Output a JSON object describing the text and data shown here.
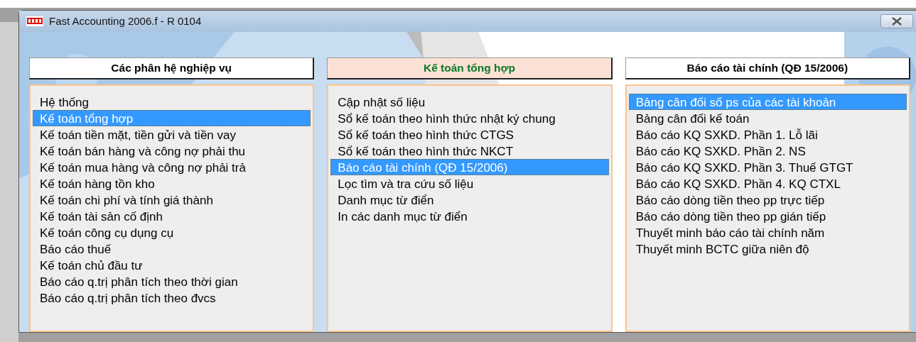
{
  "window": {
    "title": "Fast Accounting 2006.f - R 0104"
  },
  "columns": [
    {
      "header": "Các phân hệ nghiệp vụ",
      "active": false,
      "items": [
        {
          "label": "Hệ thống",
          "selected": false
        },
        {
          "label": "Kế toán tổng hợp",
          "selected": true
        },
        {
          "label": "Kế toán tiền mặt, tiền gửi và tiền vay",
          "selected": false
        },
        {
          "label": "Kế toán bán hàng và công nợ phải thu",
          "selected": false
        },
        {
          "label": "Kế toán mua hàng và công nợ phải trả",
          "selected": false
        },
        {
          "label": "Kế toán hàng tồn kho",
          "selected": false
        },
        {
          "label": "Kế toán chi phí và tính giá thành",
          "selected": false
        },
        {
          "label": "Kế toán tài sản cố định",
          "selected": false
        },
        {
          "label": "Kế toán công cụ dụng cụ",
          "selected": false
        },
        {
          "label": "Báo cáo thuế",
          "selected": false
        },
        {
          "label": "Kế toán chủ đầu tư",
          "selected": false
        },
        {
          "label": "Báo cáo q.trị phân tích theo thời gian",
          "selected": false
        },
        {
          "label": "Báo cáo q.trị phân tích theo đvcs",
          "selected": false
        }
      ]
    },
    {
      "header": "Kế toán tổng hợp",
      "active": true,
      "items": [
        {
          "label": "Cập nhật số liệu",
          "selected": false
        },
        {
          "label": "Sổ kế toán theo hình thức nhật ký chung",
          "selected": false
        },
        {
          "label": "Sổ kế toán theo hình thức CTGS",
          "selected": false
        },
        {
          "label": "Sổ kế toán theo hình thức NKCT",
          "selected": false
        },
        {
          "label": "Báo cáo tài chính (QĐ 15/2006)",
          "selected": true
        },
        {
          "label": "Lọc tìm và tra cứu số liệu",
          "selected": false
        },
        {
          "label": "Danh mục từ điển",
          "selected": false
        },
        {
          "label": "In các danh mục từ điển",
          "selected": false
        }
      ]
    },
    {
      "header": "Báo cáo tài chính (QĐ 15/2006)",
      "active": false,
      "items": [
        {
          "label": "Bảng cân đối số ps của các tài khoản",
          "selected": true
        },
        {
          "label": "Bảng cân đối kế toán",
          "selected": false
        },
        {
          "label": "Báo cáo KQ SXKD. Phần 1. Lỗ lãi",
          "selected": false
        },
        {
          "label": "Báo cáo KQ SXKD. Phần 2. NS",
          "selected": false
        },
        {
          "label": "Báo cáo KQ SXKD. Phần 3. Thuế GTGT",
          "selected": false
        },
        {
          "label": "Báo cáo KQ SXKD. Phần 4. KQ CTXL",
          "selected": false
        },
        {
          "label": "Báo cáo dòng tiền theo pp trực tiếp",
          "selected": false
        },
        {
          "label": "Báo cáo dòng tiền theo pp gián tiếp",
          "selected": false
        },
        {
          "label": "Thuyết minh báo cáo tài chính năm",
          "selected": false
        },
        {
          "label": "Thuyết minh BCTC giữa niên độ",
          "selected": false
        }
      ]
    }
  ]
}
